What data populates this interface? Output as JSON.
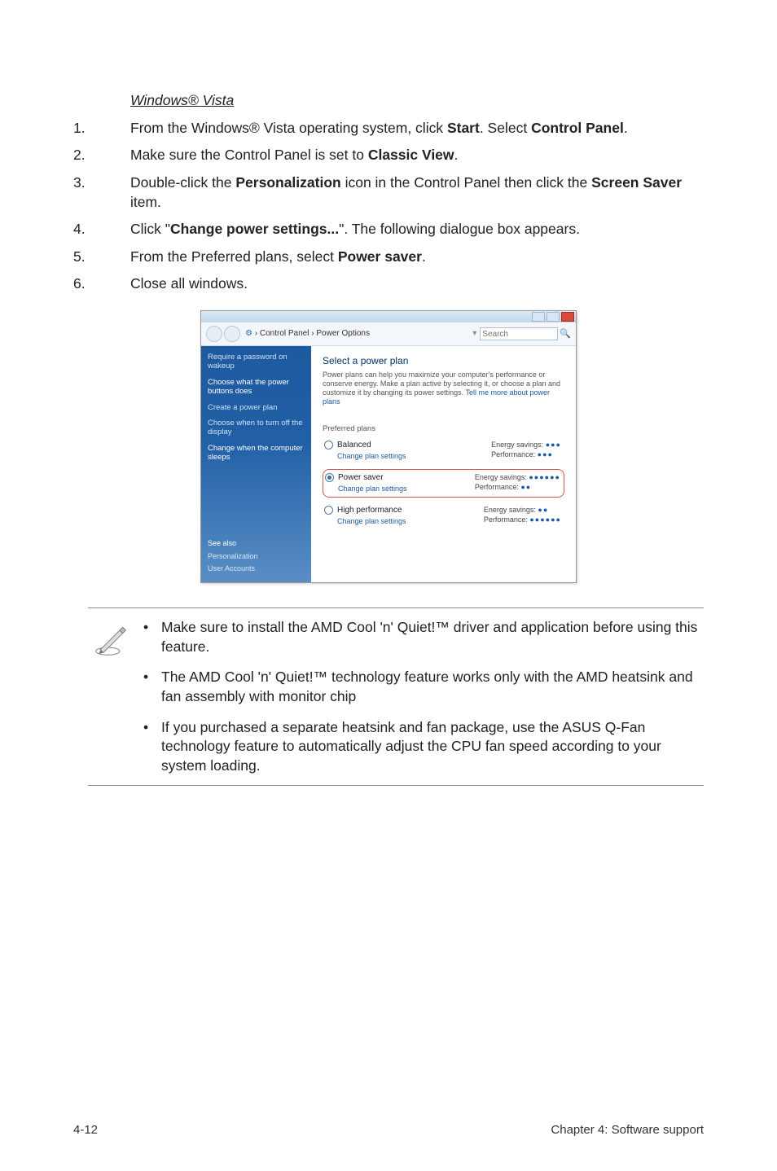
{
  "heading": {
    "windows_vista": "Windows® Vista"
  },
  "steps": [
    {
      "n": "1.",
      "t": "From the Windows® Vista operating system, click <b>Start</b>. Select <b>Control Panel</b>."
    },
    {
      "n": "2.",
      "t": "Make sure the Control Panel is set to <b>Classic View</b>."
    },
    {
      "n": "3.",
      "t": "Double-click the <b>Personalization</b> icon in the Control Panel then click the <b>Screen Saver</b> item."
    },
    {
      "n": "4.",
      "t": "Click \"<b>Change power settings...</b>\". The following dialogue box appears."
    },
    {
      "n": "5.",
      "t": "From the Preferred plans, select <b>Power saver</b>."
    },
    {
      "n": "6.",
      "t": "Close all windows."
    }
  ],
  "shot": {
    "breadcrumb": {
      "part1": "Control Panel",
      "sep": "›",
      "part2": "Power Options"
    },
    "search": {
      "label": "▾",
      "placeholder": "Search"
    },
    "sidebar": {
      "tasks": [
        "Require a password on wakeup",
        "Choose what the power buttons does",
        "Create a power plan",
        "Choose when to turn off the display",
        "Change when the computer sleeps"
      ],
      "see_also": "See also",
      "links": [
        "Personalization",
        "User Accounts"
      ]
    },
    "main": {
      "title": "Select a power plan",
      "descr": "Power plans can help you maximize your computer's performance or conserve energy. Make a plan active by selecting it, or choose a plan and customize it by changing its power settings.",
      "tell_more": "Tell me more about power plans",
      "pref": "Preferred plans",
      "plans": [
        {
          "name": "Balanced",
          "change": "Change plan settings",
          "e": "Energy savings: ",
          "es": "●●●",
          "p": "Performance: ",
          "ps": "●●●",
          "sel": false
        },
        {
          "name": "Power saver",
          "change": "Change plan settings",
          "e": "Energy savings: ",
          "es": "●●●●●●",
          "p": "Performance: ",
          "ps": "●●",
          "sel": true
        },
        {
          "name": "High performance",
          "change": "Change plan settings",
          "e": "Energy savings: ",
          "es": "●●",
          "p": "Performance: ",
          "ps": "●●●●●●",
          "sel": false
        }
      ]
    }
  },
  "notes": [
    "Make sure to install the AMD Cool 'n' Quiet!™ driver and application before using this feature.",
    "The AMD Cool 'n' Quiet!™ technology feature works only with the AMD heatsink and fan assembly with monitor chip",
    "If you purchased a separate heatsink and fan package, use the  ASUS Q-Fan technology feature to automatically adjust the CPU fan speed according to your system loading."
  ],
  "footer": {
    "left": "4-12",
    "right": "Chapter 4: Software support"
  },
  "icons": {
    "bullet": "•"
  }
}
